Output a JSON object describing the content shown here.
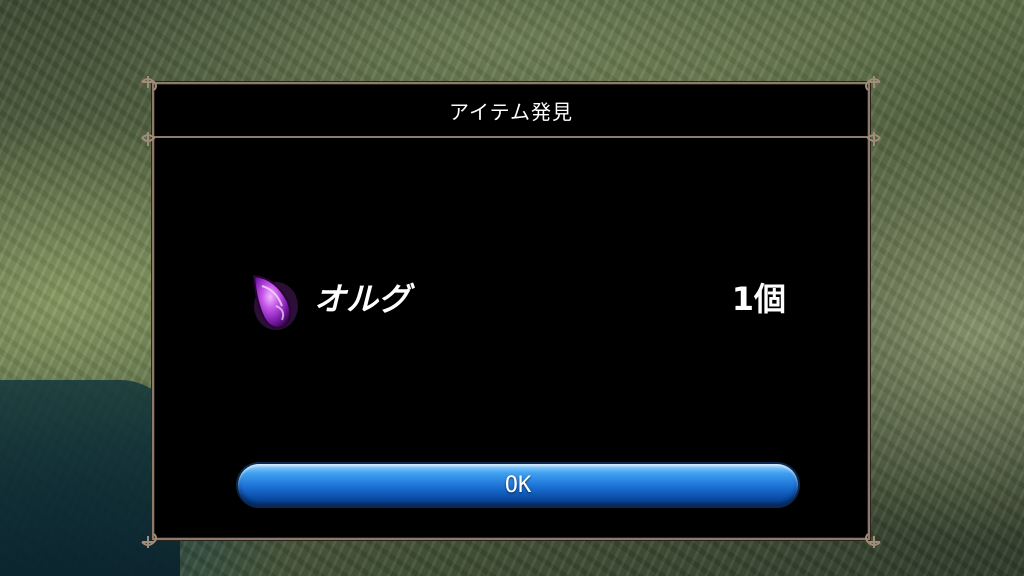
{
  "dialog": {
    "title": "アイテム発見",
    "ok_label": "OK"
  },
  "item": {
    "name": "オルグ",
    "count": "1個",
    "icon": "purple-crystal-icon",
    "icon_color": "#b23ad8"
  },
  "colors": {
    "frame": "#8c7b6a",
    "dialog_bg": "#000000",
    "button": "#1a6fd4"
  }
}
